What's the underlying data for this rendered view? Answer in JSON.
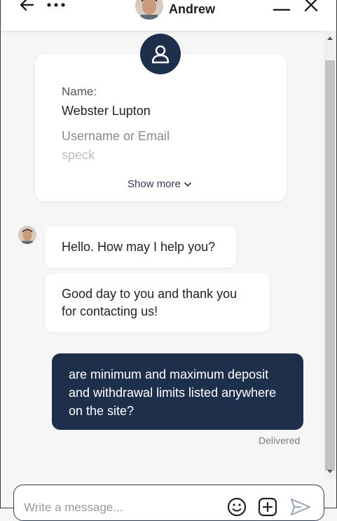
{
  "header": {
    "agent_name": "Andrew",
    "icons": [
      "back-arrow-icon",
      "more-dots-icon",
      "minimize-icon",
      "close-icon"
    ]
  },
  "profile_card": {
    "name_label": "Name:",
    "name_value": "Webster Lupton",
    "username_placeholder": "Username or Email",
    "username_value": "speck",
    "show_more_label": "Show more"
  },
  "messages": [
    {
      "from": "agent",
      "text": "Hello. How may I help you?"
    },
    {
      "from": "agent",
      "text": "Good day to you and thank you for contacting us!"
    },
    {
      "from": "user",
      "text": "are minimum and maximum deposit and withdrawal limits listed anywhere on the site?"
    }
  ],
  "status": {
    "delivered": "Delivered"
  },
  "composer": {
    "placeholder": "Write a message...",
    "icons": [
      "emoji-icon",
      "attach-icon",
      "send-icon"
    ]
  },
  "colors": {
    "accent": "#1e2f4b",
    "background": "#f6f6f6",
    "bubble_in": "#ffffff"
  }
}
